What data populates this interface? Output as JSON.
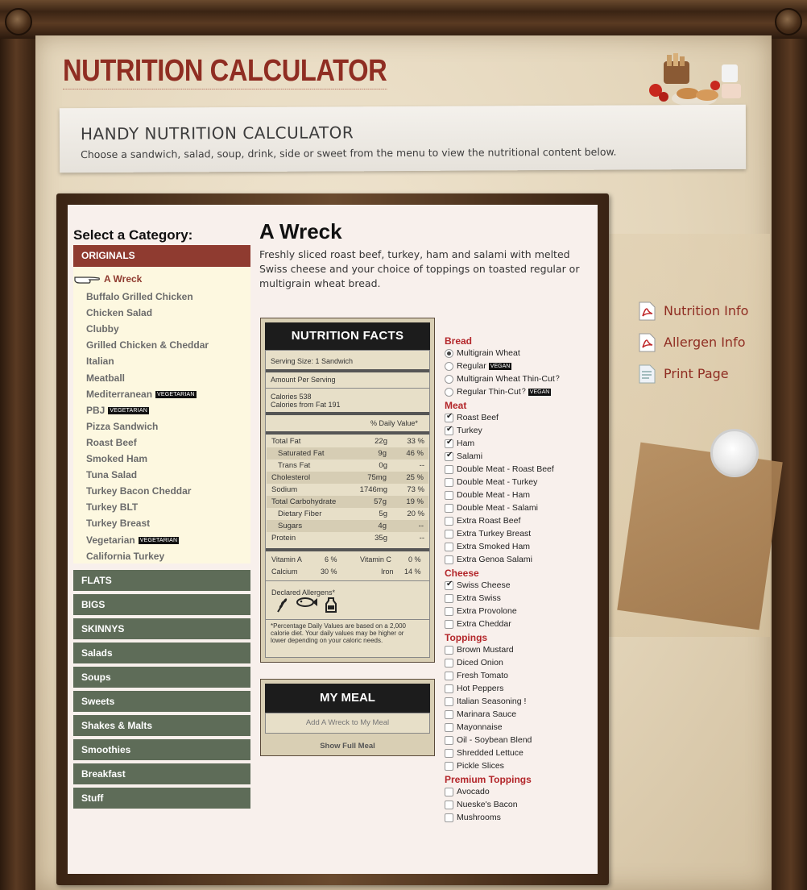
{
  "header": {
    "title": "NUTRITION CALCULATOR",
    "banner_title": "HANDY NUTRITION CALCULATOR",
    "banner_subtitle": "Choose a sandwich, salad, soup, drink, side or sweet from the menu to view the nutritional content below."
  },
  "categories": {
    "heading": "Select a Category:",
    "active": "ORIGINALS",
    "items": [
      {
        "label": "A Wreck",
        "tag": ""
      },
      {
        "label": "Buffalo Grilled Chicken",
        "tag": ""
      },
      {
        "label": "Chicken Salad",
        "tag": ""
      },
      {
        "label": "Clubby",
        "tag": ""
      },
      {
        "label": "Grilled Chicken & Cheddar",
        "tag": ""
      },
      {
        "label": "Italian",
        "tag": ""
      },
      {
        "label": "Meatball",
        "tag": ""
      },
      {
        "label": "Mediterranean",
        "tag": "VEGETARIAN"
      },
      {
        "label": "PBJ",
        "tag": "VEGETARIAN"
      },
      {
        "label": "Pizza Sandwich",
        "tag": ""
      },
      {
        "label": "Roast Beef",
        "tag": ""
      },
      {
        "label": "Smoked Ham",
        "tag": ""
      },
      {
        "label": "Tuna Salad",
        "tag": ""
      },
      {
        "label": "Turkey Bacon Cheddar",
        "tag": ""
      },
      {
        "label": "Turkey BLT",
        "tag": ""
      },
      {
        "label": "Turkey Breast",
        "tag": ""
      },
      {
        "label": "Vegetarian",
        "tag": "VEGETARIAN"
      },
      {
        "label": "California Turkey",
        "tag": ""
      }
    ],
    "others": [
      "FLATS",
      "BIGS",
      "SKINNYS",
      "Salads",
      "Soups",
      "Sweets",
      "Shakes & Malts",
      "Smoothies",
      "Breakfast",
      "Stuff"
    ]
  },
  "product": {
    "title": "A Wreck",
    "description": "Freshly sliced roast beef, turkey, ham and salami with melted Swiss cheese and your choice of toppings on toasted regular or multigrain wheat bread."
  },
  "nutrition": {
    "heading": "NUTRITION FACTS",
    "serving_size": "Serving Size: 1 Sandwich",
    "amount_per_serving": "Amount Per Serving",
    "calories": "Calories 538",
    "calories_fat": "Calories from Fat 191",
    "daily_value": "% Daily Value*",
    "rows": [
      {
        "label": "Total Fat",
        "amount": "22g",
        "pct": "33 %",
        "shade": false
      },
      {
        "label": "Saturated Fat",
        "amount": "9g",
        "pct": "46 %",
        "shade": true
      },
      {
        "label": "Trans Fat",
        "amount": "0g",
        "pct": "--",
        "shade": false
      },
      {
        "label": "Cholesterol",
        "amount": "75mg",
        "pct": "25 %",
        "shade": true
      },
      {
        "label": "Sodium",
        "amount": "1746mg",
        "pct": "73 %",
        "shade": false
      },
      {
        "label": "Total Carbohydrate",
        "amount": "57g",
        "pct": "19 %",
        "shade": true
      },
      {
        "label": "Dietary Fiber",
        "amount": "5g",
        "pct": "20 %",
        "shade": false
      },
      {
        "label": "Sugars",
        "amount": "4g",
        "pct": "--",
        "shade": true
      },
      {
        "label": "Protein",
        "amount": "35g",
        "pct": "--",
        "shade": false
      }
    ],
    "vitamin_a": "Vitamin A",
    "vitamin_a_pct": "6 %",
    "vitamin_c": "Vitamin C",
    "vitamin_c_pct": "0 %",
    "calcium": "Calcium",
    "calcium_pct": "30 %",
    "iron": "Iron",
    "iron_pct": "14 %",
    "allergens_label": "Declared Allergens*",
    "allergen_icons": [
      "wheat-icon",
      "fish-icon",
      "milk-icon"
    ],
    "footnote": "*Percentage Daily Values are based on a 2,000 calorie diet. Your daily values may be higher or lower depending on your caloric needs."
  },
  "my_meal": {
    "heading": "MY MEAL",
    "add_label": "Add A Wreck to My Meal",
    "show_label": "Show Full Meal"
  },
  "options": {
    "bread_label": "Bread",
    "bread": [
      {
        "label": "Multigrain Wheat",
        "checked": true,
        "vegan": false,
        "help": false
      },
      {
        "label": "Regular",
        "checked": false,
        "vegan": true,
        "help": false
      },
      {
        "label": "Multigrain Wheat Thin-Cut",
        "checked": false,
        "vegan": false,
        "help": true
      },
      {
        "label": "Regular Thin-Cut",
        "checked": false,
        "vegan": true,
        "help": true
      }
    ],
    "vegan_tag": "VEGAN",
    "meat_label": "Meat",
    "meat": [
      {
        "label": "Roast Beef",
        "checked": true
      },
      {
        "label": "Turkey",
        "checked": true
      },
      {
        "label": "Ham",
        "checked": true
      },
      {
        "label": "Salami",
        "checked": true
      },
      {
        "label": "Double Meat - Roast Beef",
        "checked": false
      },
      {
        "label": "Double Meat - Turkey",
        "checked": false
      },
      {
        "label": "Double Meat - Ham",
        "checked": false
      },
      {
        "label": "Double Meat - Salami",
        "checked": false
      },
      {
        "label": "Extra Roast Beef",
        "checked": false
      },
      {
        "label": "Extra Turkey Breast",
        "checked": false
      },
      {
        "label": "Extra Smoked Ham",
        "checked": false
      },
      {
        "label": "Extra Genoa Salami",
        "checked": false
      }
    ],
    "cheese_label": "Cheese",
    "cheese": [
      {
        "label": "Swiss Cheese",
        "checked": true
      },
      {
        "label": "Extra Swiss",
        "checked": false
      },
      {
        "label": "Extra Provolone",
        "checked": false
      },
      {
        "label": "Extra Cheddar",
        "checked": false
      }
    ],
    "toppings_label": "Toppings",
    "toppings": [
      {
        "label": "Brown Mustard",
        "checked": false
      },
      {
        "label": "Diced Onion",
        "checked": false
      },
      {
        "label": "Fresh Tomato",
        "checked": false
      },
      {
        "label": "Hot Peppers",
        "checked": false
      },
      {
        "label": "Italian Seasoning  !",
        "checked": false
      },
      {
        "label": "Marinara Sauce",
        "checked": false
      },
      {
        "label": "Mayonnaise",
        "checked": false
      },
      {
        "label": "Oil - Soybean Blend",
        "checked": false
      },
      {
        "label": "Shredded Lettuce",
        "checked": false
      },
      {
        "label": "Pickle Slices",
        "checked": false
      }
    ],
    "premium_label": "Premium Toppings",
    "premium": [
      {
        "label": "Avocado",
        "checked": false
      },
      {
        "label": "Nueske's Bacon",
        "checked": false
      },
      {
        "label": "Mushrooms",
        "checked": false
      }
    ]
  },
  "sidebar_links": {
    "nutrition_info": "Nutrition Info",
    "allergen_info": "Allergen Info",
    "print_page": "Print Page"
  }
}
